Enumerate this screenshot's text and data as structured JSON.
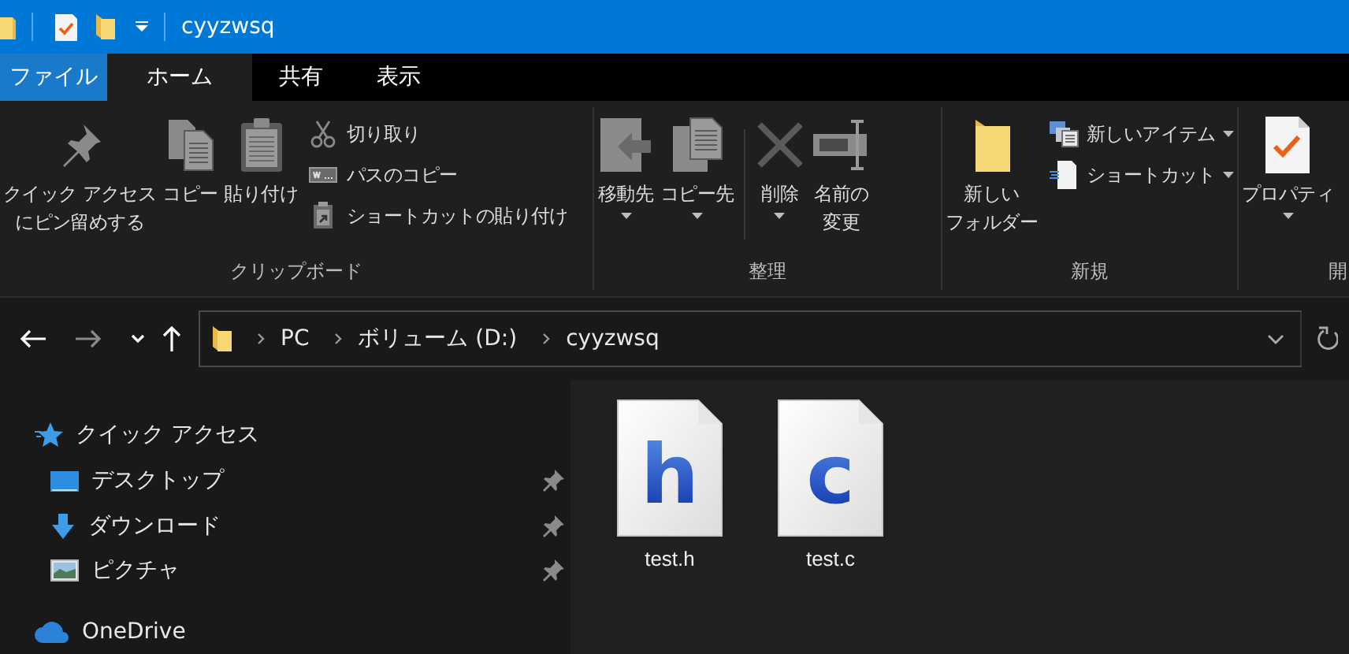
{
  "window": {
    "title": "cyyzwsq"
  },
  "tabs": [
    {
      "label": "ファイル",
      "kind": "file",
      "selected": false
    },
    {
      "label": "ホーム",
      "kind": "tab",
      "selected": true
    },
    {
      "label": "共有",
      "kind": "tab",
      "selected": false
    },
    {
      "label": "表示",
      "kind": "tab",
      "selected": false
    }
  ],
  "ribbon": {
    "groups": [
      {
        "label": "クリップボード",
        "items": [
          {
            "kind": "large",
            "lines": [
              "クイック アクセス",
              "にピン留めする"
            ],
            "dropdown": false
          },
          {
            "kind": "large",
            "lines": [
              "コピー"
            ],
            "dropdown": false
          },
          {
            "kind": "large",
            "lines": [
              "貼り付け"
            ],
            "dropdown": false
          },
          {
            "kind": "small",
            "lines": [
              "切り取り"
            ],
            "dropdown": false
          },
          {
            "kind": "small",
            "lines": [
              "パスのコピー"
            ],
            "dropdown": false
          },
          {
            "kind": "small",
            "lines": [
              "ショートカットの貼り付け"
            ],
            "dropdown": false
          }
        ]
      },
      {
        "label": "整理",
        "items": [
          {
            "kind": "large",
            "lines": [
              "移動先"
            ],
            "dropdown": true
          },
          {
            "kind": "large",
            "lines": [
              "コピー先"
            ],
            "dropdown": true
          },
          {
            "kind": "separator"
          },
          {
            "kind": "large",
            "lines": [
              "削除"
            ],
            "dropdown": true
          },
          {
            "kind": "large",
            "lines": [
              "名前の",
              "変更"
            ],
            "dropdown": false
          }
        ]
      },
      {
        "label": "新規",
        "items": [
          {
            "kind": "large",
            "lines": [
              "新しい",
              "フォルダー"
            ],
            "dropdown": false
          },
          {
            "kind": "small",
            "lines": [
              "新しいアイテム"
            ],
            "dropdown": true
          },
          {
            "kind": "small",
            "lines": [
              "ショートカット"
            ],
            "dropdown": true
          }
        ]
      },
      {
        "label": "開",
        "items": [
          {
            "kind": "large",
            "lines": [
              "プロパティ"
            ],
            "dropdown": true
          }
        ]
      }
    ]
  },
  "address": {
    "segments": [
      "PC",
      "ボリューム (D:)",
      "cyyzwsq"
    ]
  },
  "sidebar": {
    "items": [
      {
        "label": "クイック アクセス",
        "children": [
          {
            "label": "デスクトップ",
            "pinned": true
          },
          {
            "label": "ダウンロード",
            "pinned": true
          },
          {
            "label": "ピクチャ",
            "pinned": true
          }
        ]
      },
      {
        "label": "OneDrive"
      }
    ]
  },
  "files": [
    {
      "name": "test.h",
      "glyph": "h"
    },
    {
      "name": "test.c",
      "glyph": "c"
    }
  ]
}
